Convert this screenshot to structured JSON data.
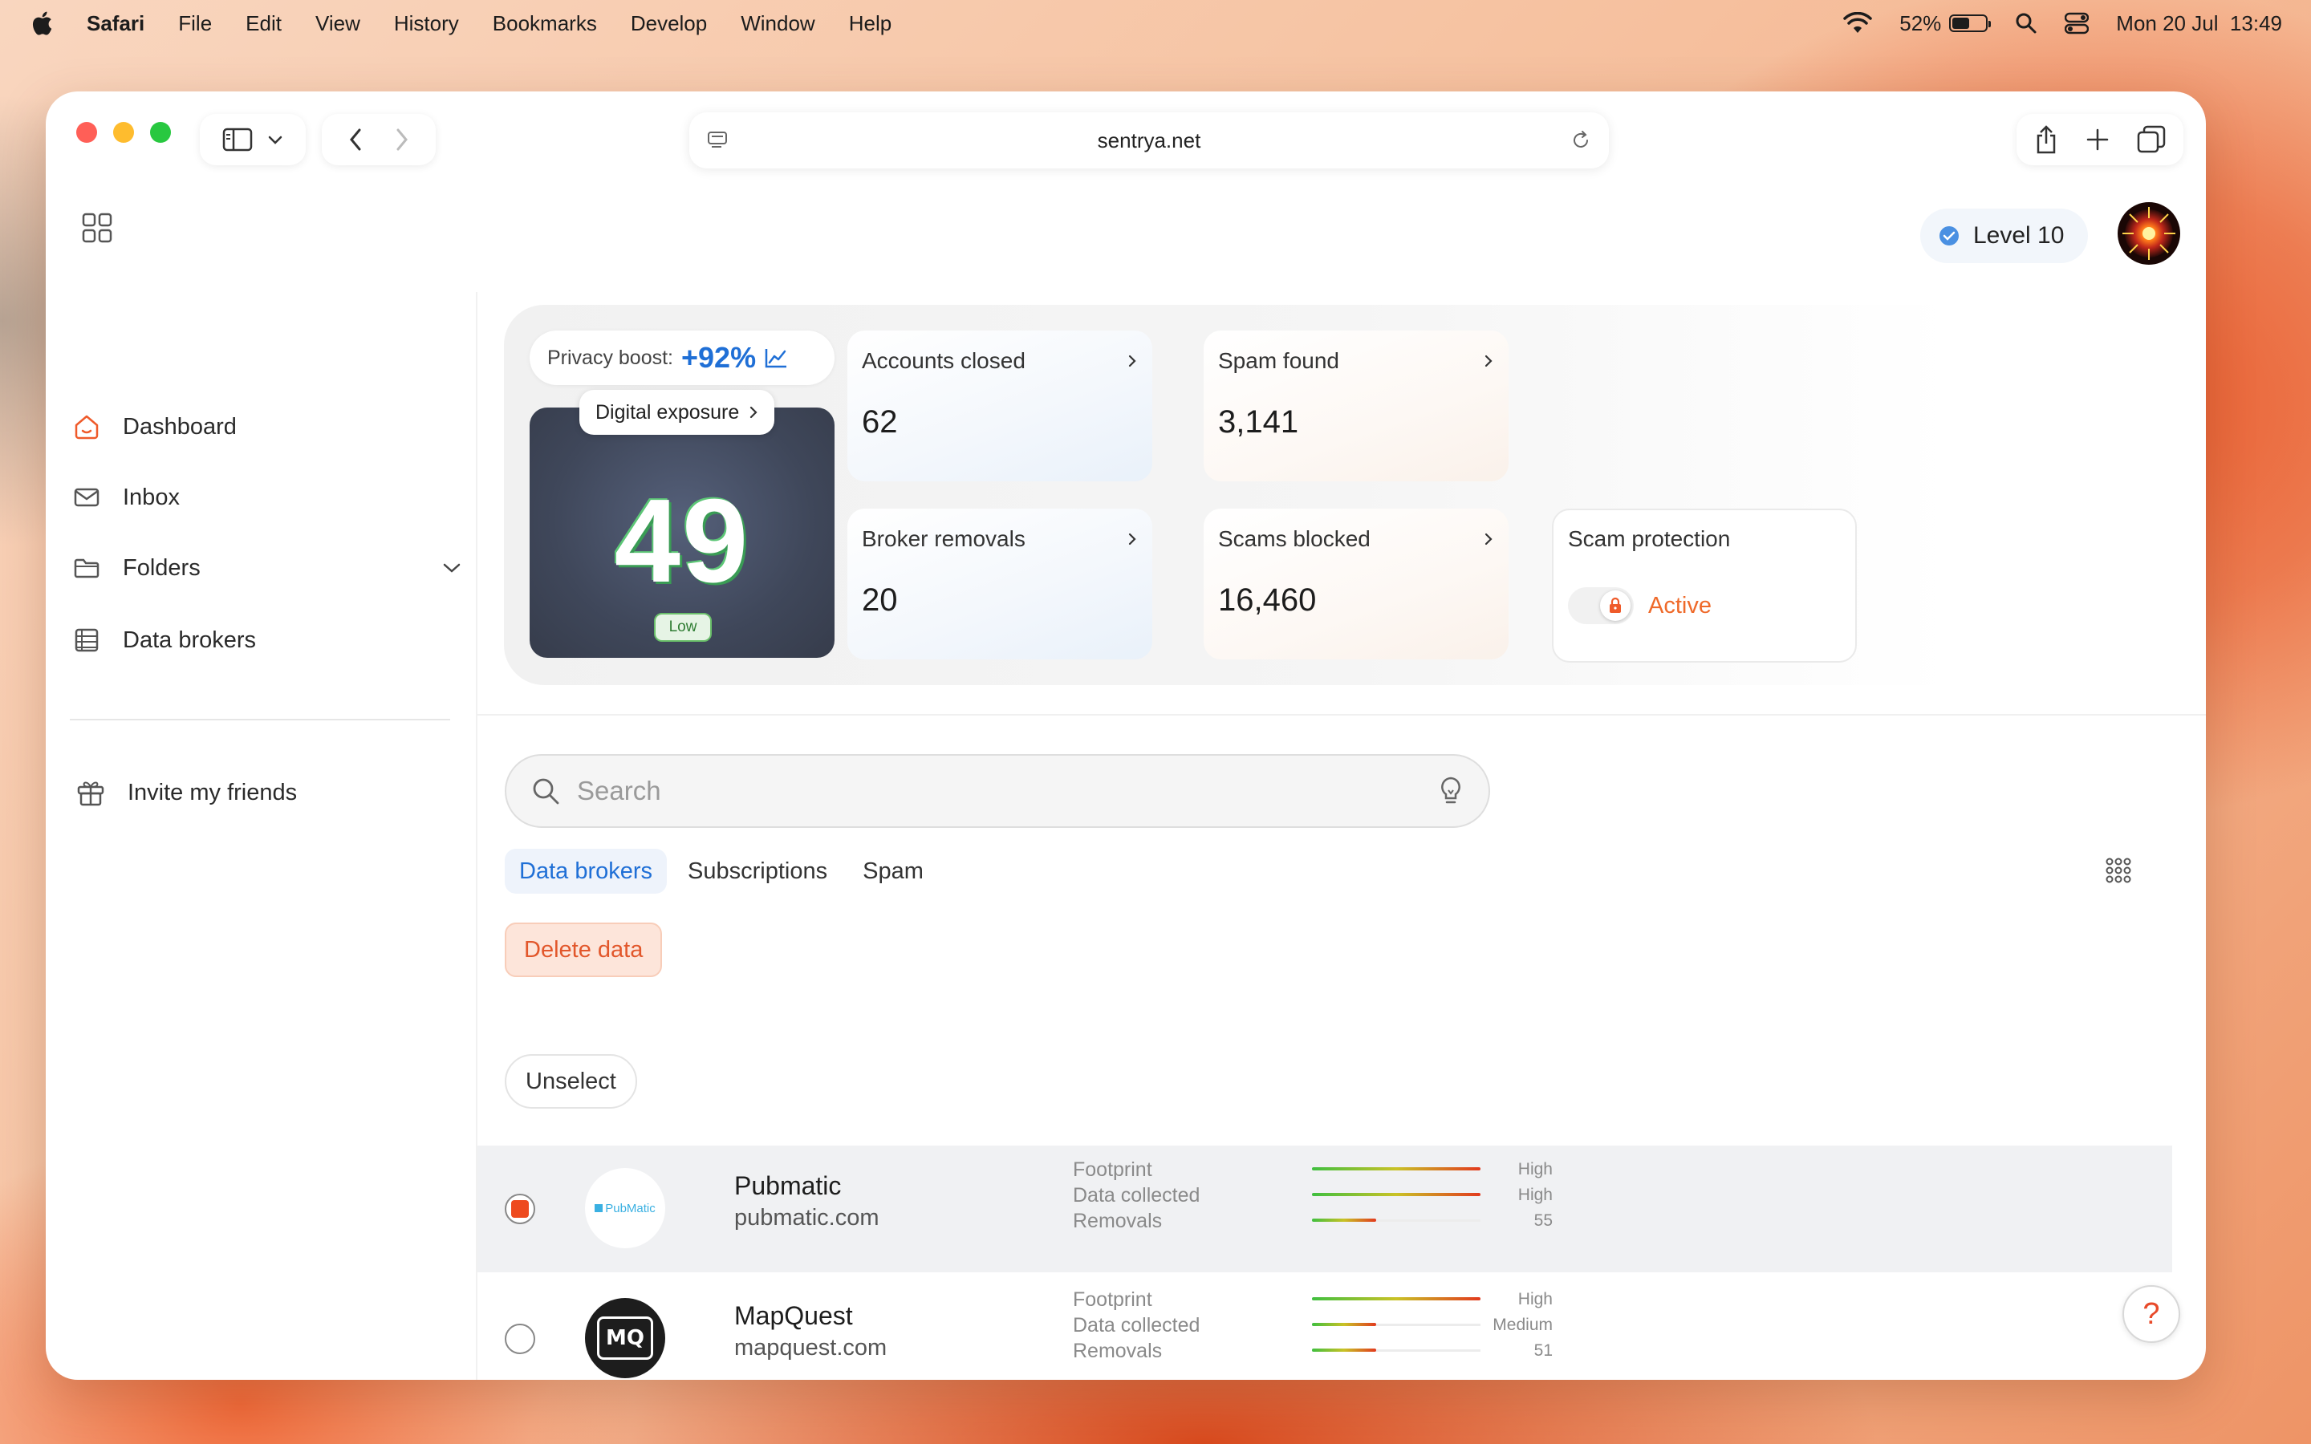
{
  "menubar": {
    "app": "Safari",
    "items": [
      "File",
      "Edit",
      "View",
      "History",
      "Bookmarks",
      "Develop",
      "Window",
      "Help"
    ],
    "battery_percent": "52%",
    "battery_level": 0.52,
    "datetime": "Mon 20 Jul  13:49"
  },
  "browser": {
    "url": "sentrya.net"
  },
  "header": {
    "level": "Level 10"
  },
  "sidebar": {
    "items": [
      {
        "label": "Dashboard",
        "icon": "home-icon"
      },
      {
        "label": "Inbox",
        "icon": "mail-icon"
      },
      {
        "label": "Folders",
        "icon": "folder-icon"
      },
      {
        "label": "Data brokers",
        "icon": "list-icon"
      }
    ],
    "invite": "Invite my friends"
  },
  "stats": {
    "boost_label": "Privacy boost:",
    "boost_value": "+92%",
    "exposure_label": "Digital exposure",
    "exposure_score": "49",
    "exposure_level": "Low",
    "accounts_closed": {
      "label": "Accounts closed",
      "value": "62"
    },
    "spam_found": {
      "label": "Spam found",
      "value": "3,141"
    },
    "broker_removals": {
      "label": "Broker removals",
      "value": "20"
    },
    "scams_blocked": {
      "label": "Scams blocked",
      "value": "16,460"
    },
    "scam_protection": {
      "label": "Scam protection",
      "status": "Active"
    }
  },
  "search": {
    "placeholder": "Search"
  },
  "tabs": [
    "Data brokers",
    "Subscriptions",
    "Spam"
  ],
  "actions": {
    "delete": "Delete data",
    "unselect": "Unselect"
  },
  "metric_labels": [
    "Footprint",
    "Data collected",
    "Removals"
  ],
  "brokers": [
    {
      "name": "Pubmatic",
      "domain": "pubmatic.com",
      "logo_text": "PubMatic",
      "selected": true,
      "footprint": "High",
      "footprint_level": 1.0,
      "data_collected": "High",
      "data_level": 1.0,
      "removals": "55",
      "removals_level": 0.38
    },
    {
      "name": "MapQuest",
      "domain": "mapquest.com",
      "logo_text": "MQ",
      "selected": false,
      "footprint": "High",
      "footprint_level": 1.0,
      "data_collected": "Medium",
      "data_level": 0.38,
      "removals": "51",
      "removals_level": 0.38
    }
  ],
  "help": "?"
}
